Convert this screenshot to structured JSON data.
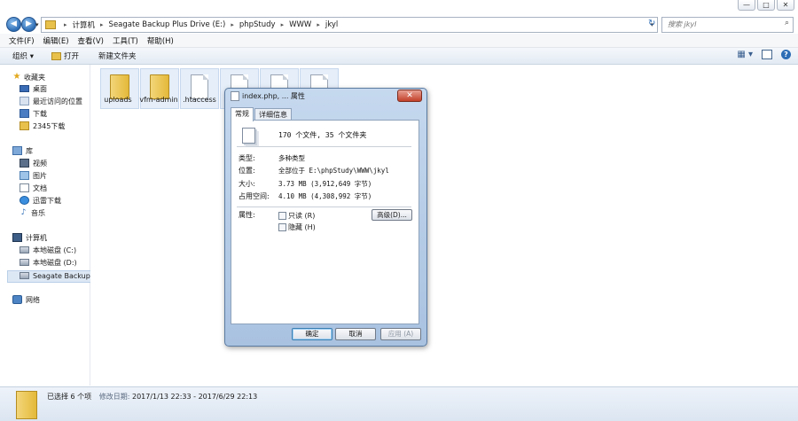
{
  "window": {
    "caption_buttons": [
      "—",
      "□",
      "✕"
    ]
  },
  "address_bar": {
    "crumbs": [
      "计算机",
      "Seagate Backup Plus Drive (E:)",
      "phpStudy",
      "WWW",
      "jkyl"
    ],
    "search_placeholder": "搜索 jkyl"
  },
  "menu": [
    "文件(F)",
    "编辑(E)",
    "查看(V)",
    "工具(T)",
    "帮助(H)"
  ],
  "command_bar": {
    "organize": "组织 ▾",
    "open": "打开",
    "new_folder": "新建文件夹"
  },
  "nav_pane": {
    "favorites": "收藏夹",
    "desktop": "桌面",
    "recent": "最近访问的位置",
    "downloads": "下载",
    "downloads_2345": "2345下载",
    "libraries": "库",
    "videos": "视频",
    "pictures": "图片",
    "documents": "文档",
    "thunder": "迅雷下载",
    "music": "音乐",
    "computer": "计算机",
    "drive_c": "本地磁盘 (C:)",
    "drive_d": "本地磁盘 (D:)",
    "drive_e": "Seagate Backup P",
    "network": "网络"
  },
  "files": [
    "uploads",
    "vfm-admin",
    ".htaccess"
  ],
  "status": {
    "selected": "已选择 6 个项",
    "modified_label": "修改日期:",
    "modified_value": "2017/1/13 22:33 - 2017/6/29 22:13"
  },
  "dialog": {
    "title": "index.php, ... 属性",
    "close": "✕",
    "tabs": [
      "常规",
      "详细信息"
    ],
    "summary": "170 个文件, 35 个文件夹",
    "rows": [
      {
        "k": "类型:",
        "v": "多种类型"
      },
      {
        "k": "位置:",
        "v": "全部位于 E:\\phpStudy\\WWW\\jkyl"
      },
      {
        "k": "大小:",
        "v": "3.73 MB (3,912,649 字节)"
      },
      {
        "k": "占用空间:",
        "v": "4.10 MB (4,308,992 字节)"
      }
    ],
    "attributes_label": "属性:",
    "readonly": "只读 (R)",
    "hidden": "隐藏 (H)",
    "advanced": "高级(D)...",
    "ok": "确定",
    "cancel": "取消",
    "apply": "应用 (A)"
  }
}
